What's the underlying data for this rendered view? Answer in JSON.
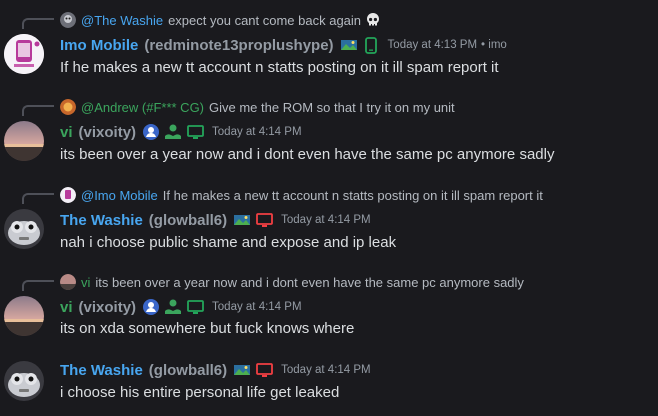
{
  "colors": {
    "background": "#1a1a1e",
    "name_blue": "#48a6f0",
    "name_green": "#3ba55d",
    "name_orange": "#e5a03c",
    "handle": "#949ba4",
    "text": "#dbdee1",
    "timestamp": "#949ba4",
    "mobile_green": "#23a55a",
    "desktop_green": "#23a55a",
    "desktop_red": "#f23f43"
  },
  "messages": [
    {
      "reply": {
        "author": "@The Washie",
        "text": "expect you cant come back again"
      },
      "author": "Imo Mobile",
      "handle": "(redminote13proplushype)",
      "timestamp": "Today at 4:13 PM",
      "suffix": "• imo",
      "content": "If he makes a new tt account n statts posting on it ill spam report it",
      "device_icon": "mobile-icon"
    },
    {
      "reply": {
        "author": "@Andrew (#F*** CG)",
        "text": "Give me the ROM so that I try it on my unit"
      },
      "author": "vi",
      "handle": "(vixoity)",
      "timestamp": "Today at 4:14 PM",
      "content": "its been over a year now and i dont even have the same pc anymore sadly",
      "device_icon": "desktop-icon"
    },
    {
      "reply": {
        "author": "@Imo Mobile",
        "text": "If he makes a new tt account n statts posting on it ill spam report it"
      },
      "author": "The Washie",
      "handle": "(glowball6)",
      "timestamp": "Today at 4:14 PM",
      "content": "nah i choose public shame and expose and ip leak",
      "device_icon": "desktop-icon"
    },
    {
      "reply": {
        "author": "vi",
        "text": "its been over a year now and i dont even have the same pc anymore sadly"
      },
      "author": "vi",
      "handle": "(vixoity)",
      "timestamp": "Today at 4:14 PM",
      "content": "its on xda somewhere but fuck knows where",
      "device_icon": "desktop-icon"
    },
    {
      "author": "The Washie",
      "handle": "(glowball6)",
      "timestamp": "Today at 4:14 PM",
      "content": "i choose his entire personal life get leaked",
      "device_icon": "desktop-icon"
    }
  ]
}
